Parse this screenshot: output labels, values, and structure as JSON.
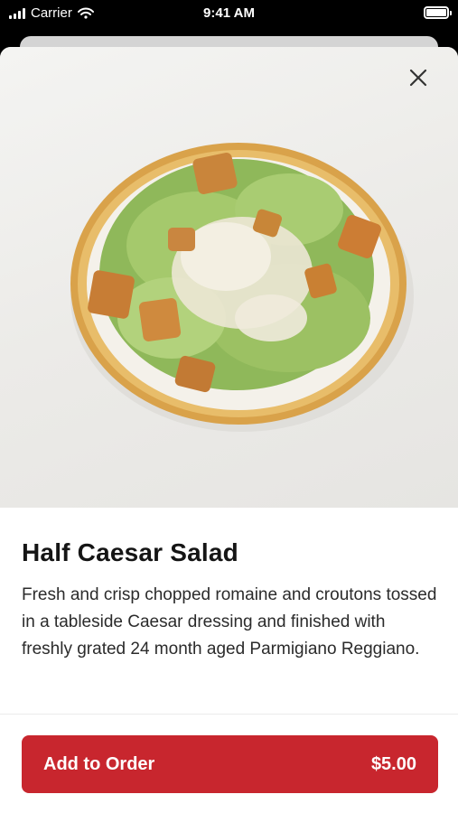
{
  "status_bar": {
    "carrier": "Carrier",
    "time": "9:41 AM"
  },
  "item": {
    "title": "Half Caesar Salad",
    "description": "Fresh and crisp chopped romaine and croutons tossed in a tableside Caesar dressing and finished with freshly grated 24 month aged Parmigiano Reggiano.",
    "image_icon": "caesar-salad-photo"
  },
  "actions": {
    "close_icon": "close-icon",
    "add_label": "Add to Order",
    "price": "$5.00"
  },
  "colors": {
    "accent": "#c8262e",
    "text": "#151515",
    "background": "#ffffff"
  }
}
